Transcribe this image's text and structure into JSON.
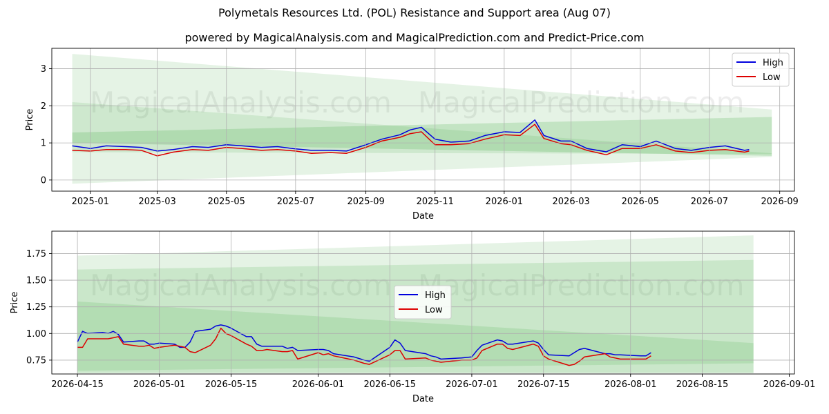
{
  "figure": {
    "title": "Polymetals Resources Ltd. (POL) Resistance and Support area (Aug 07)",
    "subtitle": "powered by MagicalAnalysis.com and MagicalPrediction.com and Predict-Price.com",
    "watermarks": [
      "MagicalAnalysis.com",
      "MagicalPrediction.com"
    ],
    "colors": {
      "high": "#0000dd",
      "low": "#dd0000",
      "band": "#2ca02c",
      "grid": "#b0b0b0"
    }
  },
  "chart_data": [
    {
      "type": "line",
      "xlabel": "Date",
      "ylabel": "Price",
      "xlim": [
        "2024-11-28",
        "2026-09-14"
      ],
      "ylim": [
        -0.3,
        3.55
      ],
      "xticks": [
        "2025-01",
        "2025-03",
        "2025-05",
        "2025-07",
        "2025-09",
        "2025-11",
        "2026-01",
        "2026-03",
        "2026-05",
        "2026-07",
        "2026-09"
      ],
      "yticks": [
        0,
        1,
        2,
        3
      ],
      "grid": true,
      "legend": "top-right",
      "series": [
        {
          "name": "High",
          "x": [
            "2024-12-16",
            "2025-01-01",
            "2025-01-15",
            "2025-02-01",
            "2025-02-15",
            "2025-03-01",
            "2025-03-15",
            "2025-04-01",
            "2025-04-15",
            "2025-05-01",
            "2025-05-15",
            "2025-06-01",
            "2025-06-15",
            "2025-07-01",
            "2025-07-15",
            "2025-08-01",
            "2025-08-15",
            "2025-09-01",
            "2025-09-15",
            "2025-10-01",
            "2025-10-10",
            "2025-10-20",
            "2025-11-01",
            "2025-11-15",
            "2025-12-01",
            "2025-12-15",
            "2026-01-01",
            "2026-01-15",
            "2026-01-28",
            "2026-02-05",
            "2026-02-20",
            "2026-03-01",
            "2026-03-15",
            "2026-04-01",
            "2026-04-15",
            "2026-05-01",
            "2026-05-15",
            "2026-06-01",
            "2026-06-15",
            "2026-07-01",
            "2026-07-15",
            "2026-08-01",
            "2026-08-05"
          ],
          "values": [
            0.92,
            0.85,
            0.92,
            0.9,
            0.88,
            0.78,
            0.82,
            0.9,
            0.88,
            0.95,
            0.92,
            0.88,
            0.9,
            0.84,
            0.8,
            0.8,
            0.78,
            0.95,
            1.1,
            1.22,
            1.35,
            1.42,
            1.1,
            1.02,
            1.05,
            1.2,
            1.3,
            1.28,
            1.62,
            1.2,
            1.05,
            1.05,
            0.85,
            0.76,
            0.95,
            0.9,
            1.05,
            0.85,
            0.8,
            0.88,
            0.92,
            0.8,
            0.82
          ]
        },
        {
          "name": "Low",
          "x": [
            "2024-12-16",
            "2025-01-01",
            "2025-01-15",
            "2025-02-01",
            "2025-02-15",
            "2025-03-01",
            "2025-03-15",
            "2025-04-01",
            "2025-04-15",
            "2025-05-01",
            "2025-05-15",
            "2025-06-01",
            "2025-06-15",
            "2025-07-01",
            "2025-07-15",
            "2025-08-01",
            "2025-08-15",
            "2025-09-01",
            "2025-09-15",
            "2025-10-01",
            "2025-10-10",
            "2025-10-20",
            "2025-11-01",
            "2025-11-15",
            "2025-12-01",
            "2025-12-15",
            "2026-01-01",
            "2026-01-15",
            "2026-01-28",
            "2026-02-05",
            "2026-02-20",
            "2026-03-01",
            "2026-03-15",
            "2026-04-01",
            "2026-04-15",
            "2026-05-01",
            "2026-05-15",
            "2026-06-01",
            "2026-06-15",
            "2026-07-01",
            "2026-07-15",
            "2026-08-01",
            "2026-08-05"
          ],
          "values": [
            0.8,
            0.78,
            0.82,
            0.82,
            0.8,
            0.65,
            0.75,
            0.82,
            0.8,
            0.88,
            0.85,
            0.8,
            0.82,
            0.78,
            0.72,
            0.74,
            0.72,
            0.88,
            1.05,
            1.15,
            1.25,
            1.3,
            0.95,
            0.95,
            0.98,
            1.1,
            1.22,
            1.2,
            1.5,
            1.12,
            0.98,
            0.95,
            0.8,
            0.68,
            0.85,
            0.85,
            0.95,
            0.78,
            0.74,
            0.8,
            0.82,
            0.75,
            0.78
          ]
        }
      ],
      "bands": [
        {
          "x": [
            "2024-12-16",
            "2026-08-25"
          ],
          "lower": [
            -0.1,
            0.62
          ],
          "upper": [
            3.4,
            1.9
          ],
          "opacity": 0.12
        },
        {
          "x": [
            "2024-12-16",
            "2026-08-25"
          ],
          "lower": [
            1.0,
            0.65
          ],
          "upper": [
            1.28,
            1.7
          ],
          "opacity": 0.18
        },
        {
          "x": [
            "2024-12-16",
            "2026-08-25"
          ],
          "lower": [
            0.75,
            0.7
          ],
          "upper": [
            2.1,
            0.72
          ],
          "opacity": 0.12
        }
      ]
    },
    {
      "type": "line",
      "xlabel": "Date",
      "ylabel": "Price",
      "xlim": [
        "2026-04-10",
        "2026-09-02"
      ],
      "ylim": [
        0.62,
        1.96
      ],
      "xticks": [
        "2026-04-15",
        "2026-05-01",
        "2026-05-15",
        "2026-06-01",
        "2026-06-15",
        "2026-07-01",
        "2026-07-15",
        "2026-08-01",
        "2026-08-15",
        "2026-09-01"
      ],
      "yticks": [
        0.75,
        1.0,
        1.25,
        1.5,
        1.75
      ],
      "grid": true,
      "legend": "center",
      "series": [
        {
          "name": "High",
          "x": [
            "2026-04-15",
            "2026-04-16",
            "2026-04-17",
            "2026-04-20",
            "2026-04-21",
            "2026-04-22",
            "2026-04-23",
            "2026-04-24",
            "2026-04-27",
            "2026-04-28",
            "2026-04-29",
            "2026-04-30",
            "2026-05-01",
            "2026-05-04",
            "2026-05-05",
            "2026-05-06",
            "2026-05-07",
            "2026-05-08",
            "2026-05-11",
            "2026-05-12",
            "2026-05-13",
            "2026-05-14",
            "2026-05-15",
            "2026-05-18",
            "2026-05-19",
            "2026-05-20",
            "2026-05-21",
            "2026-05-22",
            "2026-05-25",
            "2026-05-26",
            "2026-05-27",
            "2026-05-28",
            "2026-06-01",
            "2026-06-02",
            "2026-06-03",
            "2026-06-04",
            "2026-06-08",
            "2026-06-10",
            "2026-06-11",
            "2026-06-15",
            "2026-06-16",
            "2026-06-17",
            "2026-06-18",
            "2026-06-22",
            "2026-06-23",
            "2026-06-24",
            "2026-06-25",
            "2026-06-29",
            "2026-07-01",
            "2026-07-02",
            "2026-07-03",
            "2026-07-06",
            "2026-07-07",
            "2026-07-08",
            "2026-07-09",
            "2026-07-13",
            "2026-07-14",
            "2026-07-15",
            "2026-07-16",
            "2026-07-20",
            "2026-07-21",
            "2026-07-22",
            "2026-07-23",
            "2026-07-27",
            "2026-07-28",
            "2026-07-29",
            "2026-07-30",
            "2026-08-03",
            "2026-08-04",
            "2026-08-05"
          ],
          "values": [
            0.92,
            1.02,
            1.0,
            1.01,
            1.0,
            1.02,
            0.99,
            0.92,
            0.93,
            0.93,
            0.9,
            0.9,
            0.91,
            0.9,
            0.87,
            0.87,
            0.92,
            1.02,
            1.04,
            1.07,
            1.08,
            1.07,
            1.05,
            0.97,
            0.97,
            0.9,
            0.88,
            0.88,
            0.88,
            0.86,
            0.87,
            0.84,
            0.85,
            0.85,
            0.84,
            0.81,
            0.78,
            0.75,
            0.74,
            0.87,
            0.94,
            0.91,
            0.84,
            0.81,
            0.79,
            0.78,
            0.76,
            0.77,
            0.78,
            0.84,
            0.89,
            0.94,
            0.93,
            0.9,
            0.9,
            0.93,
            0.91,
            0.85,
            0.8,
            0.79,
            0.82,
            0.85,
            0.86,
            0.81,
            0.81,
            0.8,
            0.8,
            0.79,
            0.79,
            0.82
          ]
        },
        {
          "name": "Low",
          "x": [
            "2026-04-15",
            "2026-04-16",
            "2026-04-17",
            "2026-04-20",
            "2026-04-21",
            "2026-04-22",
            "2026-04-23",
            "2026-04-24",
            "2026-04-27",
            "2026-04-28",
            "2026-04-29",
            "2026-04-30",
            "2026-05-01",
            "2026-05-04",
            "2026-05-05",
            "2026-05-06",
            "2026-05-07",
            "2026-05-08",
            "2026-05-11",
            "2026-05-12",
            "2026-05-13",
            "2026-05-14",
            "2026-05-15",
            "2026-05-18",
            "2026-05-19",
            "2026-05-20",
            "2026-05-21",
            "2026-05-22",
            "2026-05-25",
            "2026-05-26",
            "2026-05-27",
            "2026-05-28",
            "2026-06-01",
            "2026-06-02",
            "2026-06-03",
            "2026-06-04",
            "2026-06-08",
            "2026-06-10",
            "2026-06-11",
            "2026-06-15",
            "2026-06-16",
            "2026-06-17",
            "2026-06-18",
            "2026-06-22",
            "2026-06-23",
            "2026-06-24",
            "2026-06-25",
            "2026-06-29",
            "2026-07-01",
            "2026-07-02",
            "2026-07-03",
            "2026-07-06",
            "2026-07-07",
            "2026-07-08",
            "2026-07-09",
            "2026-07-13",
            "2026-07-14",
            "2026-07-15",
            "2026-07-16",
            "2026-07-20",
            "2026-07-21",
            "2026-07-22",
            "2026-07-23",
            "2026-07-27",
            "2026-07-28",
            "2026-07-29",
            "2026-07-30",
            "2026-08-03",
            "2026-08-04",
            "2026-08-05"
          ],
          "values": [
            0.87,
            0.87,
            0.95,
            0.95,
            0.95,
            0.96,
            0.97,
            0.9,
            0.88,
            0.88,
            0.89,
            0.86,
            0.87,
            0.89,
            0.88,
            0.87,
            0.83,
            0.82,
            0.89,
            0.95,
            1.05,
            1.0,
            0.98,
            0.9,
            0.88,
            0.84,
            0.84,
            0.85,
            0.83,
            0.83,
            0.84,
            0.76,
            0.82,
            0.8,
            0.81,
            0.79,
            0.75,
            0.72,
            0.71,
            0.8,
            0.84,
            0.84,
            0.76,
            0.77,
            0.75,
            0.74,
            0.73,
            0.75,
            0.75,
            0.77,
            0.84,
            0.9,
            0.9,
            0.86,
            0.85,
            0.9,
            0.88,
            0.79,
            0.76,
            0.7,
            0.71,
            0.74,
            0.78,
            0.81,
            0.78,
            0.77,
            0.76,
            0.76,
            0.76,
            0.79
          ]
        }
      ],
      "bands": [
        {
          "x": [
            "2026-04-15",
            "2026-08-25"
          ],
          "lower": [
            0.63,
            0.63
          ],
          "upper": [
            1.73,
            1.92
          ],
          "opacity": 0.12
        },
        {
          "x": [
            "2026-04-15",
            "2026-08-25"
          ],
          "lower": [
            0.63,
            0.63
          ],
          "upper": [
            1.6,
            1.69
          ],
          "opacity": 0.14
        },
        {
          "x": [
            "2026-04-15",
            "2026-08-25"
          ],
          "lower": [
            0.65,
            0.72
          ],
          "upper": [
            1.3,
            0.91
          ],
          "opacity": 0.14
        }
      ]
    }
  ]
}
